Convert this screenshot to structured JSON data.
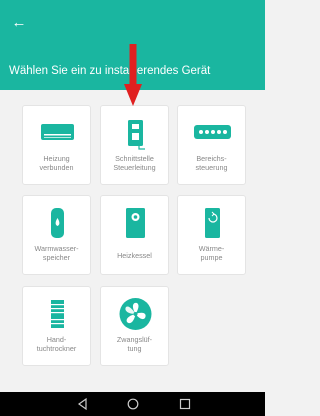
{
  "header": {
    "title": "Wählen Sie ein zu installierendes Gerät",
    "bg_color": "#1ab6a0"
  },
  "devices": [
    {
      "label": [
        "Heizung",
        "verbunden"
      ],
      "icon": "ac-unit-icon"
    },
    {
      "label": [
        "Schnittstelle",
        "Steuerleitung"
      ],
      "icon": "interface-module-icon"
    },
    {
      "label": [
        "Bereichs-",
        "steuerung"
      ],
      "icon": "zone-controller-icon"
    },
    {
      "label": [
        "Warmwasser-",
        "speicher"
      ],
      "icon": "water-heater-icon"
    },
    {
      "label": [
        "Heizkessel"
      ],
      "icon": "boiler-icon"
    },
    {
      "label": [
        "Wärme-",
        "pumpe"
      ],
      "icon": "heat-pump-icon"
    },
    {
      "label": [
        "Hand-",
        "tuchtrockner"
      ],
      "icon": "towel-dryer-icon"
    },
    {
      "label": [
        "Zwangslüf-",
        "tung"
      ],
      "icon": "fan-icon"
    }
  ],
  "colors": {
    "accent": "#1ab6a0",
    "arrow": "#e02020"
  }
}
